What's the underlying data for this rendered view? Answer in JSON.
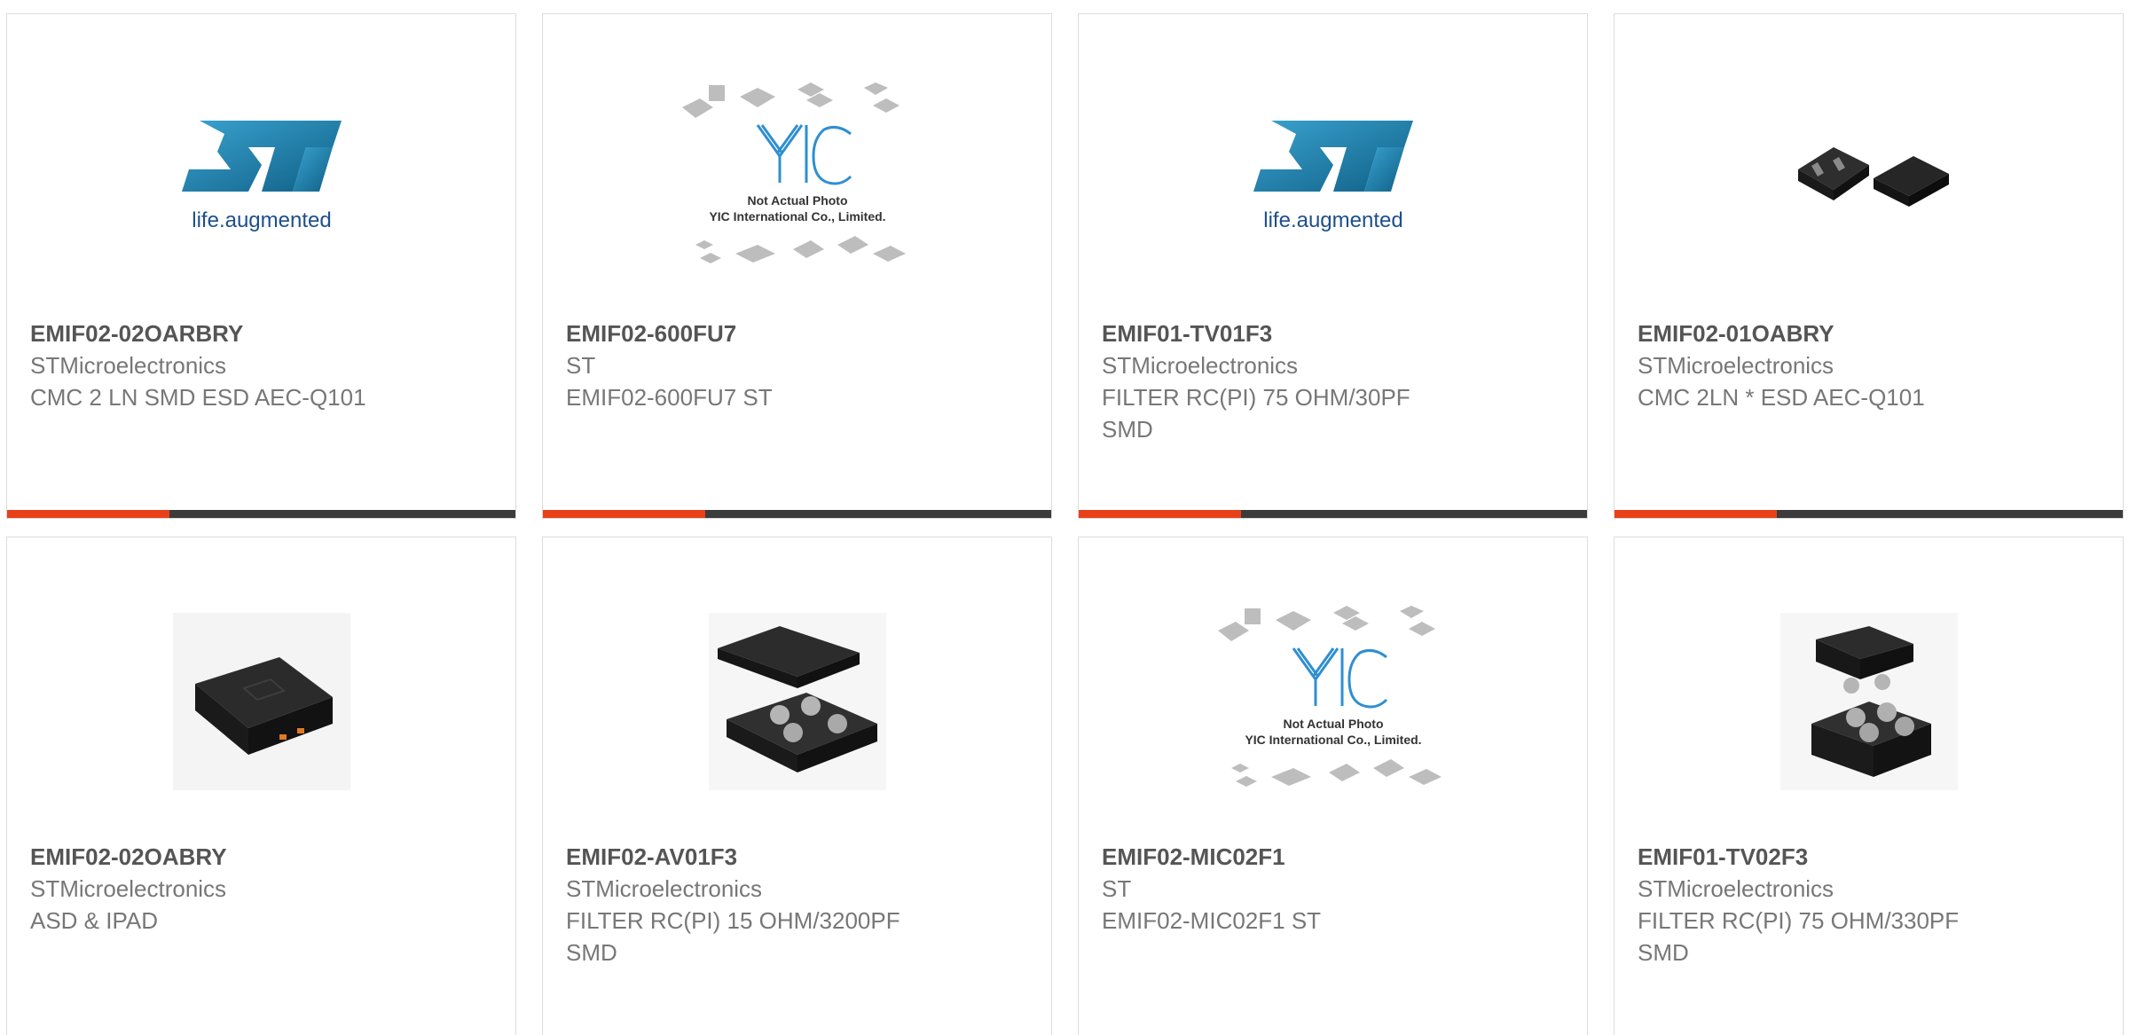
{
  "colors": {
    "accent": "#e8411a",
    "bar": "#3b3b3b",
    "border": "#dcdcdc",
    "text": "#777777"
  },
  "products": [
    {
      "part_number": "EMIF02-02OARBRY",
      "manufacturer": "STMicroelectronics",
      "desc1": "CMC 2 LN SMD ESD AEC-Q101",
      "desc2": "",
      "image": "st-logo",
      "logo_tagline": "life.augmented"
    },
    {
      "part_number": "EMIF02-600FU7",
      "manufacturer": "ST",
      "desc1": "EMIF02-600FU7 ST",
      "desc2": "",
      "image": "yic-placeholder",
      "placeholder_line1": "Not Actual Photo",
      "placeholder_line2": "YIC International Co., Limited."
    },
    {
      "part_number": "EMIF01-TV01F3",
      "manufacturer": "STMicroelectronics",
      "desc1": "FILTER RC(PI) 75 OHM/30PF",
      "desc2": "SMD",
      "image": "st-logo",
      "logo_tagline": "life.augmented"
    },
    {
      "part_number": "EMIF02-01OABRY",
      "manufacturer": "STMicroelectronics",
      "desc1": "CMC 2LN * ESD AEC-Q101",
      "desc2": "",
      "image": "dfn-chips"
    },
    {
      "part_number": "EMIF02-02OABRY",
      "manufacturer": "STMicroelectronics",
      "desc1": "ASD & IPAD",
      "desc2": "",
      "image": "qfn-chip"
    },
    {
      "part_number": "EMIF02-AV01F3",
      "manufacturer": "STMicroelectronics",
      "desc1": "FILTER RC(PI) 15 OHM/3200PF",
      "desc2": "SMD",
      "image": "csp-chip"
    },
    {
      "part_number": "EMIF02-MIC02F1",
      "manufacturer": "ST",
      "desc1": "EMIF02-MIC02F1 ST",
      "desc2": "",
      "image": "yic-placeholder",
      "placeholder_line1": "Not Actual Photo",
      "placeholder_line2": "YIC International Co., Limited."
    },
    {
      "part_number": "EMIF01-TV02F3",
      "manufacturer": "STMicroelectronics",
      "desc1": "FILTER RC(PI) 75 OHM/330PF",
      "desc2": "SMD",
      "image": "csp-chip"
    }
  ]
}
